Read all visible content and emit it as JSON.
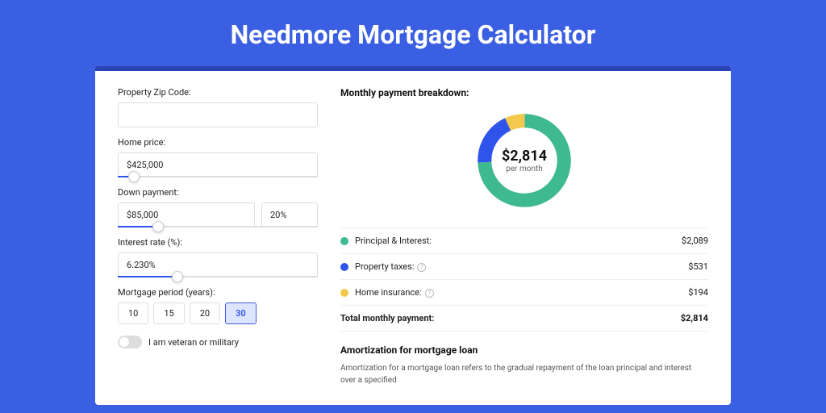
{
  "title": "Needmore Mortgage Calculator",
  "form": {
    "zip": {
      "label": "Property Zip Code:",
      "value": ""
    },
    "price": {
      "label": "Home price:",
      "value": "$425,000",
      "slider_pct": 8
    },
    "down": {
      "label": "Down payment:",
      "amount": "$85,000",
      "pct": "20%",
      "slider_pct": 20
    },
    "rate": {
      "label": "Interest rate (%):",
      "value": "6.230%",
      "slider_pct": 30
    },
    "period": {
      "label": "Mortgage period (years):",
      "options": [
        "10",
        "15",
        "20",
        "30"
      ],
      "selected": "30"
    },
    "veteran": {
      "label": "I am veteran or military",
      "checked": false
    }
  },
  "breakdown": {
    "heading": "Monthly payment breakdown:",
    "total_amount": "$2,814",
    "per_month": "per month",
    "items": [
      {
        "name": "Principal & Interest:",
        "value": "$2,089",
        "color": "#3FB98F",
        "help": false,
        "deg": 267
      },
      {
        "name": "Property taxes:",
        "value": "$531",
        "color": "#2F54EB",
        "help": true,
        "deg": 68
      },
      {
        "name": "Home insurance:",
        "value": "$194",
        "color": "#F2C94C",
        "help": true,
        "deg": 25
      }
    ],
    "total_row": {
      "name": "Total monthly payment:",
      "value": "$2,814"
    }
  },
  "amort": {
    "heading": "Amortization for mortgage loan",
    "text": "Amortization for a mortgage loan refers to the gradual repayment of the loan principal and interest over a specified"
  }
}
